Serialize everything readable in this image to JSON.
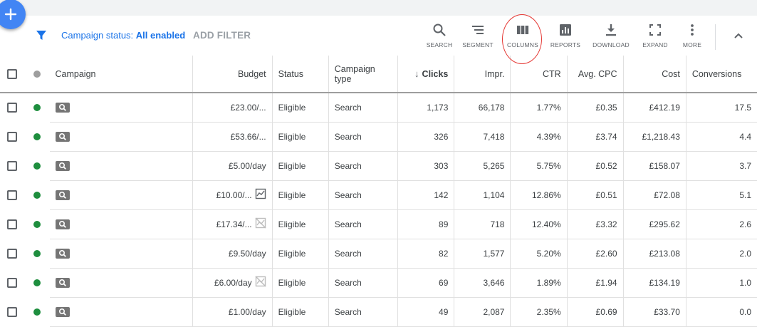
{
  "filter": {
    "prefix": "Campaign status: ",
    "value": "All enabled",
    "add_filter": "ADD FILTER"
  },
  "toolbar": [
    {
      "key": "search",
      "label": "SEARCH",
      "icon": "search-icon"
    },
    {
      "key": "segment",
      "label": "SEGMENT",
      "icon": "segment-icon"
    },
    {
      "key": "columns",
      "label": "COLUMNS",
      "icon": "columns-icon"
    },
    {
      "key": "reports",
      "label": "REPORTS",
      "icon": "reports-icon"
    },
    {
      "key": "download",
      "label": "DOWNLOAD",
      "icon": "download-icon"
    },
    {
      "key": "expand",
      "label": "EXPAND",
      "icon": "expand-icon"
    },
    {
      "key": "more",
      "label": "MORE",
      "icon": "more-vert-icon"
    }
  ],
  "colors": {
    "accent": "#1a73e8",
    "enabled": "#1e8e3e",
    "highlight": "#e53935",
    "fab": "#4285f4"
  },
  "table": {
    "headers": {
      "campaign": "Campaign",
      "budget": "Budget",
      "status": "Status",
      "type": "Campaign type",
      "clicks": "Clicks",
      "impr": "Impr.",
      "ctr": "CTR",
      "cpc": "Avg. CPC",
      "cost": "Cost",
      "conv": "Conversions"
    },
    "sort_indicator": "↓",
    "rows": [
      {
        "budget": "£23.00/...",
        "budget_icon": "",
        "status": "Eligible",
        "type": "Search",
        "clicks": "1,173",
        "impr": "66,178",
        "ctr": "1.77%",
        "cpc": "£0.35",
        "cost": "£412.19",
        "conv": "17.5"
      },
      {
        "budget": "£53.66/...",
        "budget_icon": "",
        "status": "Eligible",
        "type": "Search",
        "clicks": "326",
        "impr": "7,418",
        "ctr": "4.39%",
        "cpc": "£3.74",
        "cost": "£1,218.43",
        "conv": "4.4"
      },
      {
        "budget": "£5.00/day",
        "budget_icon": "",
        "status": "Eligible",
        "type": "Search",
        "clicks": "303",
        "impr": "5,265",
        "ctr": "5.75%",
        "cpc": "£0.52",
        "cost": "£158.07",
        "conv": "3.7"
      },
      {
        "budget": "£10.00/...",
        "budget_icon": "trend-chart-icon",
        "status": "Eligible",
        "type": "Search",
        "clicks": "142",
        "impr": "1,104",
        "ctr": "12.86%",
        "cpc": "£0.51",
        "cost": "£72.08",
        "conv": "5.1"
      },
      {
        "budget": "£17.34/...",
        "budget_icon": "trend-off-icon",
        "status": "Eligible",
        "type": "Search",
        "clicks": "89",
        "impr": "718",
        "ctr": "12.40%",
        "cpc": "£3.32",
        "cost": "£295.62",
        "conv": "2.6"
      },
      {
        "budget": "£9.50/day",
        "budget_icon": "",
        "status": "Eligible",
        "type": "Search",
        "clicks": "82",
        "impr": "1,577",
        "ctr": "5.20%",
        "cpc": "£2.60",
        "cost": "£213.08",
        "conv": "2.0"
      },
      {
        "budget": "£6.00/day",
        "budget_icon": "trend-off-icon",
        "status": "Eligible",
        "type": "Search",
        "clicks": "69",
        "impr": "3,646",
        "ctr": "1.89%",
        "cpc": "£1.94",
        "cost": "£134.19",
        "conv": "1.0"
      },
      {
        "budget": "£1.00/day",
        "budget_icon": "",
        "status": "Eligible",
        "type": "Search",
        "clicks": "49",
        "impr": "2,087",
        "ctr": "2.35%",
        "cpc": "£0.69",
        "cost": "£33.70",
        "conv": "0.0"
      }
    ]
  }
}
